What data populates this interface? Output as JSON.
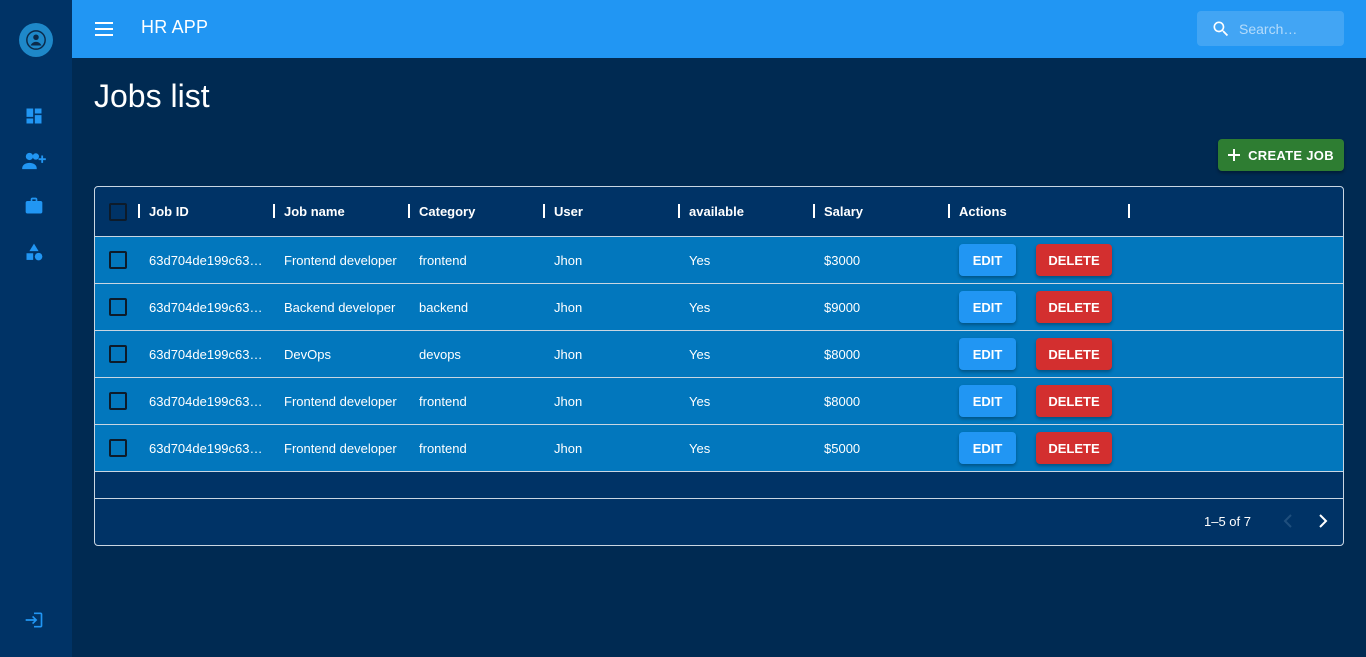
{
  "app": {
    "title": "HR APP",
    "accent": "#2196f3"
  },
  "search": {
    "placeholder": "Search…",
    "value": ""
  },
  "page": {
    "title": "Jobs list"
  },
  "toolbar": {
    "create_label": "CREATE JOB",
    "create_color": "#2e7d32"
  },
  "sidebar": {
    "items": [
      {
        "icon": "dashboard-icon"
      },
      {
        "icon": "person-add-icon"
      },
      {
        "icon": "briefcase-icon"
      },
      {
        "icon": "category-shapes-icon"
      }
    ],
    "logout_icon": "logout-icon"
  },
  "table": {
    "columns": [
      "Job ID",
      "Job name",
      "Category",
      "User",
      "available",
      "Salary",
      "Actions"
    ],
    "rows": [
      {
        "id": "63d704de199c631…",
        "name": "Frontend developer",
        "category": "frontend",
        "user": "Jhon",
        "available": "Yes",
        "salary": "$3000"
      },
      {
        "id": "63d704de199c631…",
        "name": "Backend developer",
        "category": "backend",
        "user": "Jhon",
        "available": "Yes",
        "salary": "$9000"
      },
      {
        "id": "63d704de199c631…",
        "name": "DevOps",
        "category": "devops",
        "user": "Jhon",
        "available": "Yes",
        "salary": "$8000"
      },
      {
        "id": "63d704de199c631…",
        "name": "Frontend developer",
        "category": "frontend",
        "user": "Jhon",
        "available": "Yes",
        "salary": "$8000"
      },
      {
        "id": "63d704de199c631…",
        "name": "Frontend developer",
        "category": "frontend",
        "user": "Jhon",
        "available": "Yes",
        "salary": "$5000"
      }
    ],
    "edit_label": "EDIT",
    "delete_label": "DELETE",
    "edit_color": "#2196f3",
    "delete_color": "#d32f2f"
  },
  "pagination": {
    "label": "1–5 of 7"
  }
}
